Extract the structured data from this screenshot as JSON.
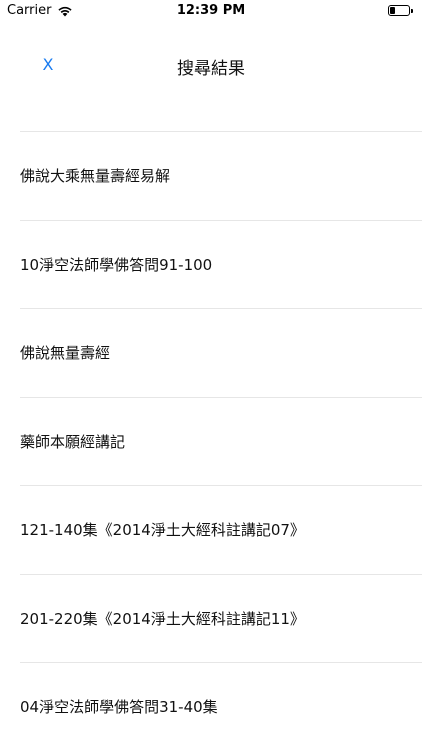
{
  "status_bar": {
    "carrier": "Carrier",
    "time": "12:39 PM"
  },
  "nav": {
    "close_label": "X",
    "title": "搜尋結果"
  },
  "results": [
    {
      "label": "佛說大乘無量壽經易解"
    },
    {
      "label": "10淨空法師學佛答問91-100"
    },
    {
      "label": "佛說無量壽經"
    },
    {
      "label": "藥師本願經講記"
    },
    {
      "label": "121-140集《2014淨土大經科註講記07》"
    },
    {
      "label": "201-220集《2014淨土大經科註講記11》"
    },
    {
      "label": "04淨空法師學佛答問31-40集"
    }
  ],
  "colors": {
    "accent": "#1a7cf0",
    "divider": "#e6e6e6"
  }
}
